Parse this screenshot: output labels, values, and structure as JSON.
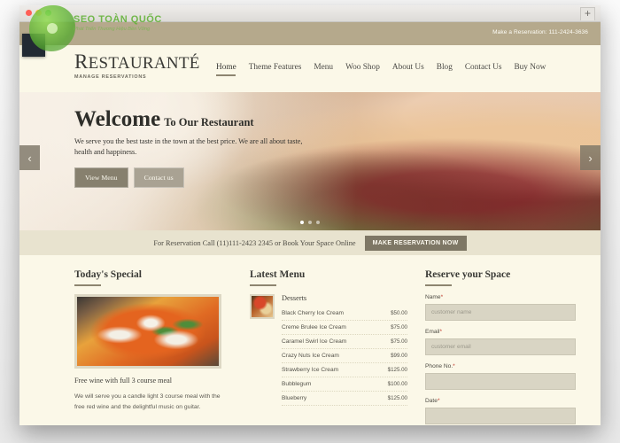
{
  "browser": {
    "traffic_lights": [
      "close",
      "minimize",
      "maximize"
    ],
    "new_tab_label": "+"
  },
  "watermark": {
    "title": "SEO TOÀN QUỐC",
    "tagline": "Phát Triển Thương Hiệu Bền Vững"
  },
  "topbar": {
    "reservation_text": "Make a Reservation: 111-2424-3636"
  },
  "brand": {
    "initial": "R",
    "rest": "ESTAURANTÉ",
    "tagline": "MANAGE RESERVATIONS"
  },
  "nav": {
    "items": [
      {
        "label": "Home",
        "active": true
      },
      {
        "label": "Theme Features",
        "active": false
      },
      {
        "label": "Menu",
        "active": false
      },
      {
        "label": "Woo Shop",
        "active": false
      },
      {
        "label": "About Us",
        "active": false
      },
      {
        "label": "Blog",
        "active": false
      },
      {
        "label": "Contact Us",
        "active": false
      },
      {
        "label": "Buy Now",
        "active": false
      }
    ]
  },
  "hero": {
    "heading": "Welcome",
    "subheading": "To Our Restaurant",
    "paragraph": "We serve you the best taste in the town at the best price. We are all about taste, health and happiness.",
    "primary_button": "View Menu",
    "secondary_button": "Contact us",
    "prev_arrow": "‹",
    "next_arrow": "›",
    "slide_count": 3,
    "active_slide": 1
  },
  "strip": {
    "text": "For Reservation Call (11)111-2423 2345 or Book Your Space Online",
    "cta": "MAKE RESERVATION NOW"
  },
  "special": {
    "title": "Today's Special",
    "lead": "Free wine with full 3 course meal",
    "body": "We will serve you a candle light 3 course meal with the free red wine and the delightful music on guitar."
  },
  "menu": {
    "title": "Latest Menu",
    "category": "Desserts",
    "items": [
      {
        "name": "Black Cherry Ice Cream",
        "price": "$50.00"
      },
      {
        "name": "Creme Brulee Ice Cream",
        "price": "$75.00"
      },
      {
        "name": "Caramel Swirl Ice Cream",
        "price": "$75.00"
      },
      {
        "name": "Crazy Nuts Ice Cream",
        "price": "$99.00"
      },
      {
        "name": "Strawberry Ice Cream",
        "price": "$125.00"
      },
      {
        "name": "Bubblegum",
        "price": "$100.00"
      },
      {
        "name": "Blueberry",
        "price": "$125.00"
      }
    ]
  },
  "reserve": {
    "title": "Reserve your Space",
    "fields": [
      {
        "label": "Name",
        "required": "*",
        "placeholder": "customer name"
      },
      {
        "label": "Email",
        "required": "*",
        "placeholder": "customer email"
      },
      {
        "label": "Phone No.",
        "required": "*",
        "placeholder": ""
      },
      {
        "label": "Date",
        "required": "*",
        "placeholder": ""
      }
    ]
  },
  "colors": {
    "topbar": "#b5a98c",
    "page_bg": "#fbf8e8",
    "accent": "#8d8570",
    "button": "#7e7765",
    "required": "#c0392b"
  }
}
